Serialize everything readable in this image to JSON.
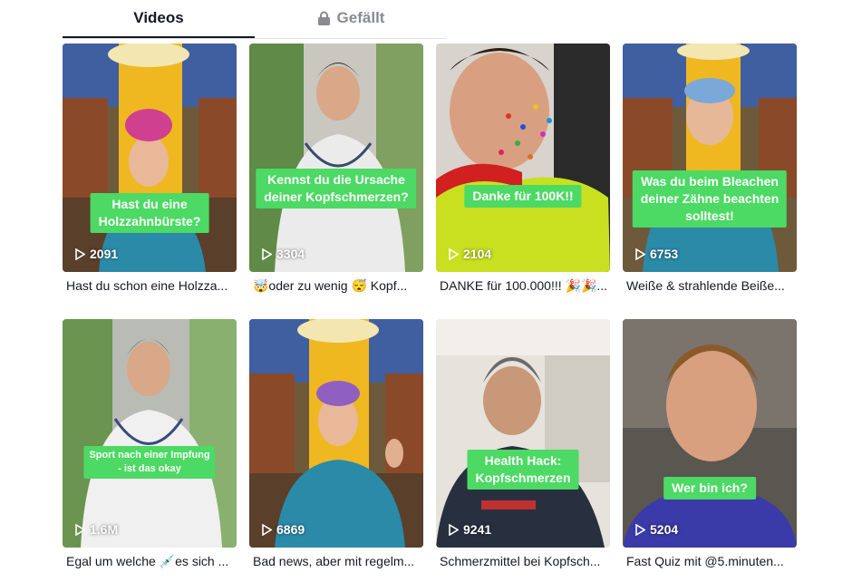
{
  "tabs": {
    "videos": "Videos",
    "liked": "Gefällt"
  },
  "colors": {
    "caption_green": "#4cd964",
    "tab_active": "#161823",
    "tab_inactive": "#8a8b91"
  },
  "videos": [
    {
      "caption_lines": [
        "Hast du eine",
        "Holzzahnbürste?"
      ],
      "views": "2091",
      "title": "Hast du schon eine Holzza..."
    },
    {
      "caption_lines": [
        "Kennst du die Ursache",
        "deiner Kopfschmerzen?"
      ],
      "views": "3304",
      "title": "🤯oder zu wenig 😴 Kopf..."
    },
    {
      "caption_lines": [
        "Danke für 100K!!"
      ],
      "views": "2104",
      "title": "DANKE für 100.000!!! 🎉🎉..."
    },
    {
      "caption_lines": [
        "Was du beim Bleachen",
        "deiner Zähne beachten",
        "solltest!"
      ],
      "views": "6753",
      "title": "Weiße & strahlende Beiße..."
    },
    {
      "caption_lines": [
        "Sport nach einer Impfung",
        "- ist das okay"
      ],
      "views": "1.6M",
      "title": "Egal um welche 💉es sich ..."
    },
    {
      "caption_lines": [],
      "views": "6869",
      "title": "Bad news, aber mit regelm..."
    },
    {
      "caption_lines": [
        "Health Hack:",
        "Kopfschmerzen"
      ],
      "views": "9241",
      "title": "Schmerzmittel bei Kopfsch..."
    },
    {
      "caption_lines": [
        "Wer bin ich?"
      ],
      "views": "5204",
      "title": "Fast Quiz mit @5.minuten..."
    }
  ]
}
